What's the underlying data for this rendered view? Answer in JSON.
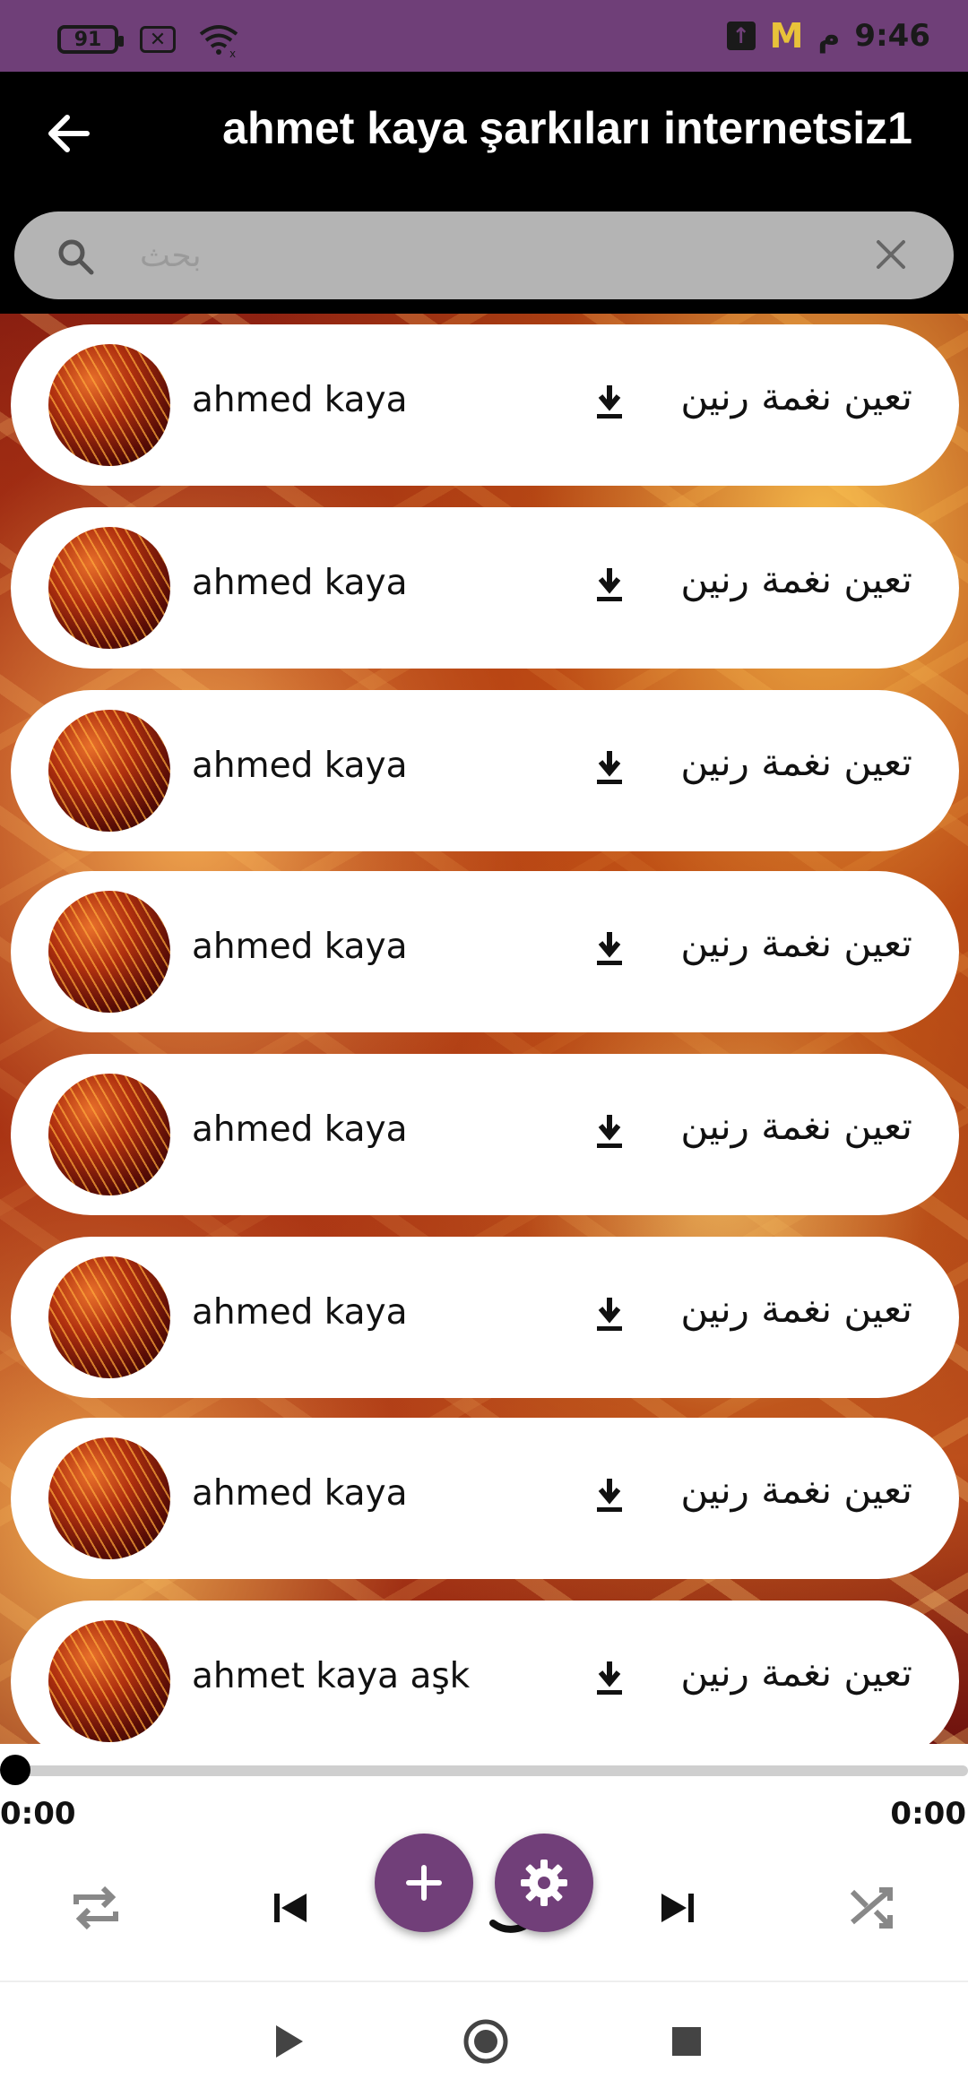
{
  "status_bar": {
    "battery": "91",
    "time": "9:46",
    "period": "م",
    "icons": [
      "battery-icon",
      "no-sim-icon",
      "wifi-icon",
      "upload-icon",
      "m-logo-icon"
    ]
  },
  "app_bar": {
    "title": "ahmet kaya şarkıları internetsiz1",
    "back_icon": "arrow-back-icon"
  },
  "search": {
    "placeholder": "بحث",
    "search_icon": "search-icon",
    "clear_icon": "close-icon"
  },
  "songs": [
    {
      "title": "ahmed kaya",
      "action_label": "تعين نغمة رنين"
    },
    {
      "title": "ahmed kaya",
      "action_label": "تعين نغمة رنين"
    },
    {
      "title": "ahmed kaya",
      "action_label": "تعين نغمة رنين"
    },
    {
      "title": "ahmed kaya",
      "action_label": "تعين نغمة رنين"
    },
    {
      "title": "ahmed kaya",
      "action_label": "تعين نغمة رنين"
    },
    {
      "title": "ahmed kaya",
      "action_label": "تعين نغمة رنين"
    },
    {
      "title": "ahmed kaya",
      "action_label": "تعين نغمة رنين"
    },
    {
      "title": "ahmet kaya aşk",
      "action_label": "تعين نغمة رنين"
    }
  ],
  "player": {
    "current_time": "0:00",
    "total_time": "0:00",
    "progress": 0,
    "controls": [
      "repeat-icon",
      "skip-previous-icon",
      "add-icon",
      "settings-icon",
      "skip-next-icon",
      "shuffle-icon"
    ]
  },
  "nav_bar": {
    "icons": [
      "play-icon",
      "record-icon",
      "stop-icon"
    ]
  },
  "colors": {
    "accent": "#713f79",
    "status_bar": "#6f3f78",
    "app_bar": "#000000",
    "search_bg": "#b4b4b4"
  }
}
